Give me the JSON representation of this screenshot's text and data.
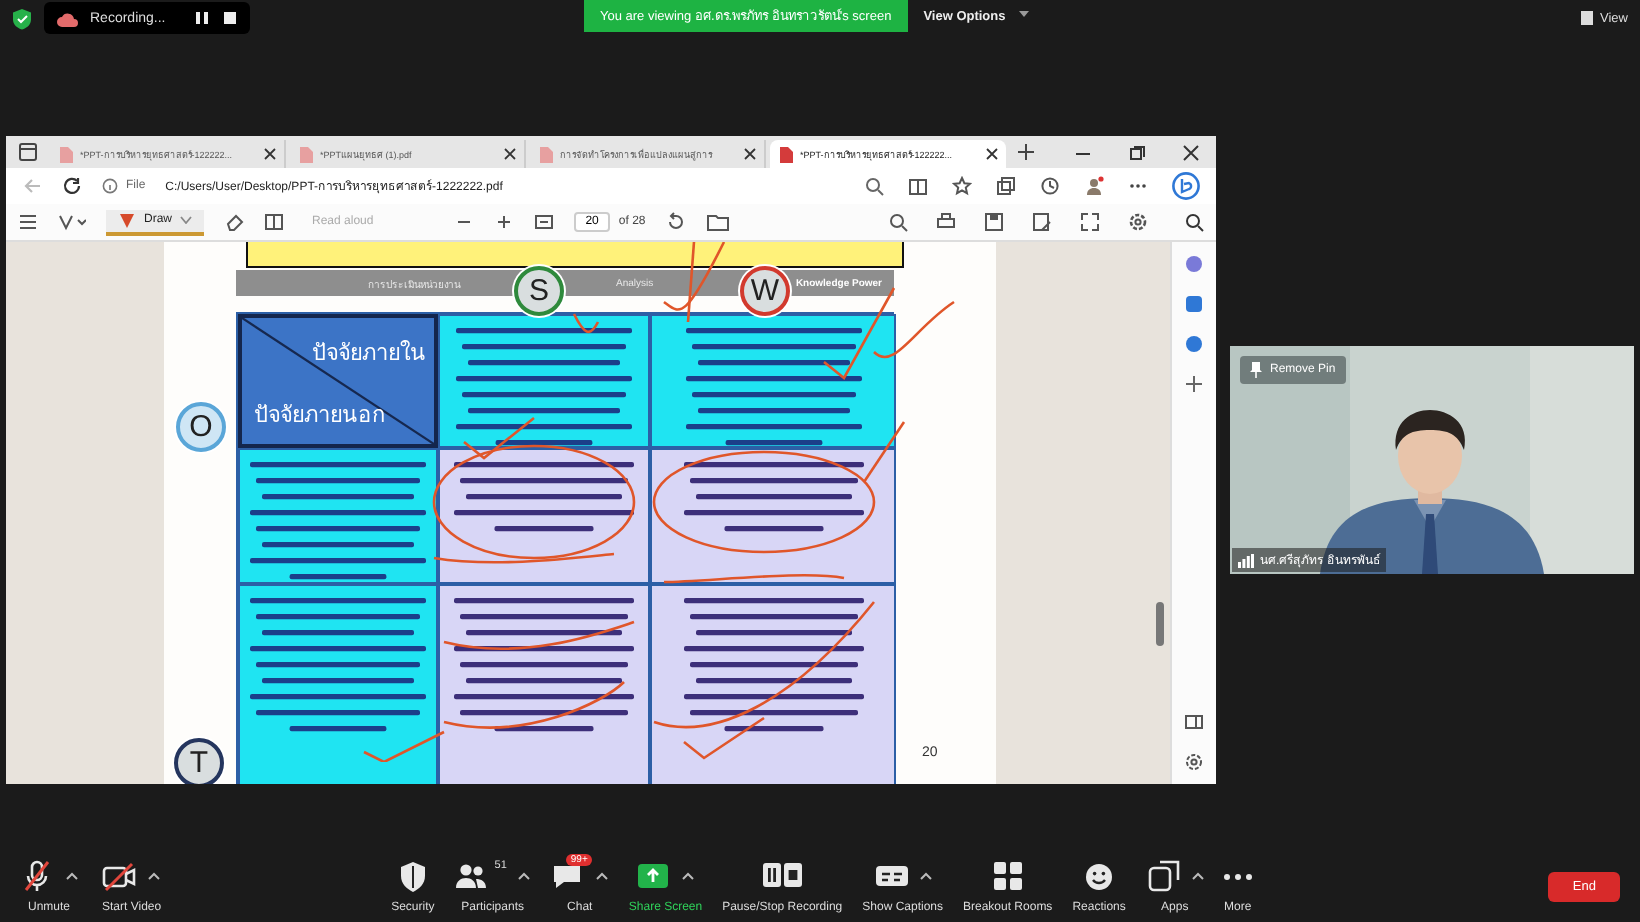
{
  "meeting_bar": {
    "recording": "Recording...",
    "banner": "You are viewing อศ.ดร.พรภัทร อินทราวรัตน์'s screen",
    "view_options": "View Options",
    "view": "View"
  },
  "browser": {
    "tabs": [
      {
        "title": "*PPT-การบริหารยุทธศาสตร์-122222...",
        "selected": false
      },
      {
        "title": "*PPTแผนยุทธศ (1).pdf",
        "selected": false
      },
      {
        "title": "การจัดทำโครงการเพื่อแปลงแผนสู่การ",
        "selected": false
      },
      {
        "title": "*PPT-การบริหารยุทธศาสตร์-122222...",
        "selected": true
      }
    ],
    "address_label": "File",
    "url": "C:/Users/User/Desktop/PPT-การบริหารยุทธศาสตร์-1222222.pdf",
    "draw": "Draw",
    "read_aloud": "Read aloud",
    "page": "20",
    "page_total": "of 28"
  },
  "slide": {
    "subtitle": "การประเมินหน่วยงาน",
    "subtitle_mid": "Analysis",
    "subtitle_right": "Knowledge Power",
    "internal": "ปัจจัยภายใน",
    "external": "ปัจจัยภายนอก",
    "page_number": "20",
    "badges": [
      {
        "letter": "S",
        "color": "#2f8a3c"
      },
      {
        "letter": "W",
        "color": "#d23a2e"
      },
      {
        "letter": "O",
        "color": "#5aa6d8"
      },
      {
        "letter": "T",
        "color": "#24355e"
      }
    ]
  },
  "video": {
    "pin": "Remove Pin",
    "name": "นศ.ศรีสุภัทร อินทรพันธ์"
  },
  "toolbar": [
    {
      "label": "Unmute",
      "kind": "mic"
    },
    {
      "label": "Start Video",
      "kind": "video"
    },
    {
      "label": "Security",
      "kind": "security"
    },
    {
      "label": "Participants",
      "kind": "participants",
      "count": "51"
    },
    {
      "label": "Chat",
      "kind": "chat",
      "badge": "99+"
    },
    {
      "label": "Share Screen",
      "kind": "share"
    },
    {
      "label": "Pause/Stop Recording",
      "kind": "record"
    },
    {
      "label": "Show Captions",
      "kind": "captions"
    },
    {
      "label": "Breakout Rooms",
      "kind": "breakout"
    },
    {
      "label": "Reactions",
      "kind": "reactions"
    },
    {
      "label": "Apps",
      "kind": "apps"
    },
    {
      "label": "More",
      "kind": "more"
    }
  ],
  "end": "End"
}
